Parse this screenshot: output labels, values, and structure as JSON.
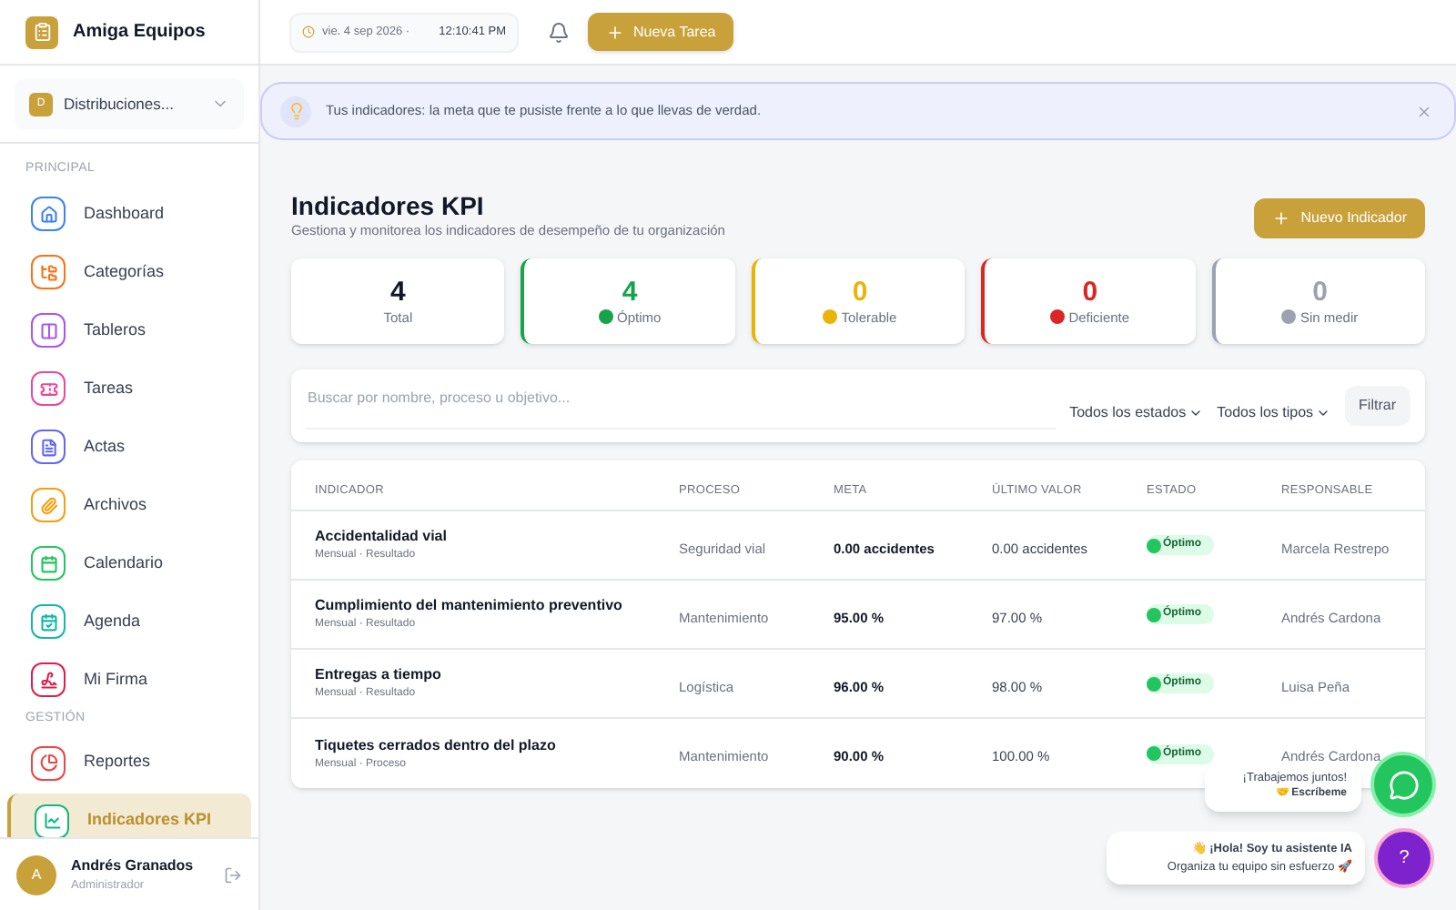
{
  "app": {
    "name": "Amiga Equipos"
  },
  "org_selector": {
    "initial": "D",
    "label": "Distribuciones..."
  },
  "sidebar": {
    "sections": [
      {
        "title": "PRINCIPAL",
        "items": [
          {
            "label": "Dashboard",
            "color": "#3b82f6",
            "selected": false
          },
          {
            "label": "Categorías",
            "color": "#f97316",
            "selected": false
          },
          {
            "label": "Tableros",
            "color": "#a855f7",
            "selected": false
          },
          {
            "label": "Tareas",
            "color": "#ec4899",
            "selected": false
          },
          {
            "label": "Actas",
            "color": "#6366f1",
            "selected": false
          },
          {
            "label": "Archivos",
            "color": "#f59e0b",
            "selected": false
          },
          {
            "label": "Calendario",
            "color": "#22c55e",
            "selected": false
          },
          {
            "label": "Agenda",
            "color": "#14b8a6",
            "selected": false
          },
          {
            "label": "Mi Firma",
            "color": "#e11d48",
            "selected": false
          }
        ]
      },
      {
        "title": "GESTIÓN",
        "items": [
          {
            "label": "Reportes",
            "color": "#ef4444",
            "selected": false
          },
          {
            "label": "Indicadores KPI",
            "color": "#10b981",
            "selected": true
          }
        ]
      }
    ]
  },
  "user": {
    "initial": "A",
    "name": "Andrés Granados",
    "role": "Administrador"
  },
  "header": {
    "date": "vie. 4 sep 2026 ·",
    "time": "12:10:41 PM",
    "new_task": "Nueva Tarea"
  },
  "banner": {
    "text": "Tus indicadores: la meta que te pusiste frente a lo que llevas de verdad."
  },
  "page": {
    "title": "Indicadores KPI",
    "subtitle": "Gestiona y monitorea los indicadores de desempeño de tu organización",
    "new_button": "Nuevo Indicador"
  },
  "kpi_cards": [
    {
      "value": "4",
      "label": "Total",
      "color": "#111827",
      "kind": "total"
    },
    {
      "value": "4",
      "label": "Óptimo",
      "color": "#16a34a",
      "kind": "status"
    },
    {
      "value": "0",
      "label": "Tolerable",
      "color": "#eab308",
      "kind": "status"
    },
    {
      "value": "0",
      "label": "Deficiente",
      "color": "#dc2626",
      "kind": "status"
    },
    {
      "value": "0",
      "label": "Sin medir",
      "color": "#9ca3af",
      "kind": "status"
    }
  ],
  "filters": {
    "search_placeholder": "Buscar por nombre, proceso u objetivo...",
    "status_select": "Todos los estados",
    "type_select": "Todos los tipos",
    "filter_button": "Filtrar"
  },
  "table": {
    "columns": [
      "INDICADOR",
      "PROCESO",
      "META",
      "ÚLTIMO VALOR",
      "ESTADO",
      "RESPONSABLE"
    ],
    "rows": [
      {
        "name": "Accidentalidad vial",
        "meta_info": "Mensual · Resultado",
        "process": "Seguridad vial",
        "goal": "0.00 accidentes",
        "last_value": "0.00 accidentes",
        "status": "Óptimo",
        "color": "#22c55e",
        "owner": "Marcela Restrepo"
      },
      {
        "name": "Cumplimiento del mantenimiento preventivo",
        "meta_info": "Mensual · Resultado",
        "process": "Mantenimiento",
        "goal": "95.00 %",
        "last_value": "97.00 %",
        "status": "Óptimo",
        "color": "#22c55e",
        "owner": "Andrés Cardona"
      },
      {
        "name": "Entregas a tiempo",
        "meta_info": "Mensual · Resultado",
        "process": "Logística",
        "goal": "96.00 %",
        "last_value": "98.00 %",
        "status": "Óptimo",
        "color": "#22c55e",
        "owner": "Luisa Peña"
      },
      {
        "name": "Tiquetes cerrados dentro del plazo",
        "meta_info": "Mensual · Proceso",
        "process": "Mantenimiento",
        "goal": "90.00 %",
        "last_value": "100.00 %",
        "status": "Óptimo",
        "color": "#22c55e",
        "owner": "Andrés Cardona"
      }
    ]
  },
  "whatsapp": {
    "line1": "¡Trabajemos juntos!",
    "line2": "🤝 Escríbeme"
  },
  "assistant": {
    "line1": "👋 ¡Hola! Soy tu asistente IA",
    "line2": "Organiza tu equipo sin esfuerzo 🚀",
    "button": "?"
  }
}
